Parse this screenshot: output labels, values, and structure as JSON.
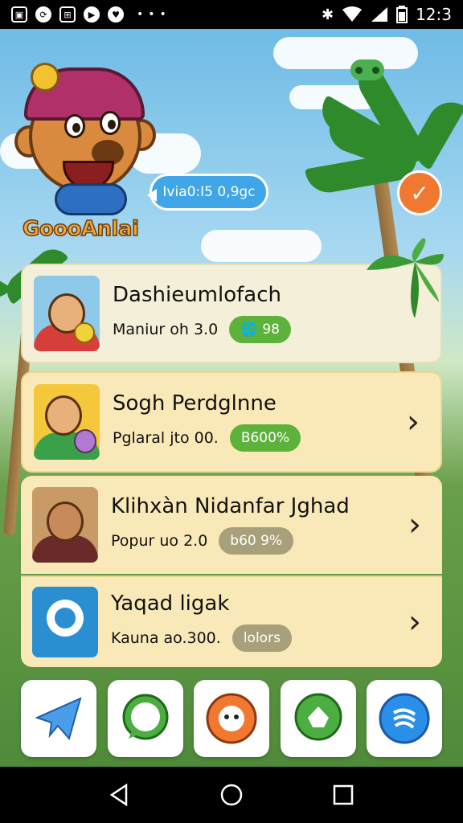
{
  "status_bar": {
    "time": "12:3",
    "left_icons": [
      "gallery-icon",
      "sync-icon",
      "grid-icon",
      "play-icon",
      "heart-icon"
    ],
    "right_icons": [
      "bluetooth-icon",
      "wifi-icon",
      "signal-icon",
      "battery-icon"
    ]
  },
  "header": {
    "brand_name": "GoooAnlai",
    "speech_bubble": "Ivia0:I5 0,9gc"
  },
  "cards": [
    {
      "title": "Dashieumlofach",
      "subtitle": "Maniur oh 3.0",
      "badge": "98",
      "badge_style": "green"
    },
    {
      "title": "Sogh Perdglnne",
      "subtitle": "Pglaral jto 00.",
      "badge": "B600%",
      "badge_style": "green"
    },
    {
      "title": "Klihxàn Nidanfar Jghad",
      "subtitle": "Popur uo 2.0",
      "badge": "b60 9%",
      "badge_style": "gray"
    },
    {
      "title": "Yaqad ligak",
      "subtitle": "Kauna ao.300.",
      "badge": "lolors",
      "badge_style": "gray"
    }
  ],
  "dock": [
    "telegram-icon",
    "whatsapp-icon",
    "bot-icon",
    "chat-icon",
    "shazam-icon"
  ],
  "nav": [
    "back-icon",
    "home-icon",
    "recents-icon"
  ],
  "colors": {
    "accent": "#5cb23a",
    "orange": "#f07830",
    "card": "#fae9b8"
  }
}
